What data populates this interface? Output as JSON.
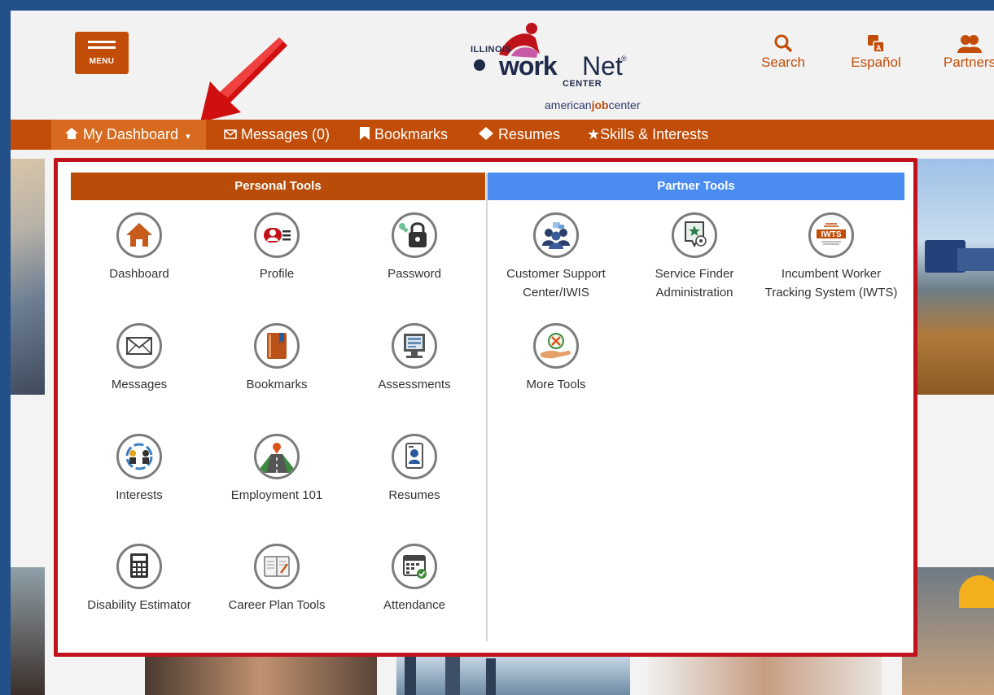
{
  "header": {
    "menu_label": "MENU",
    "logo": {
      "state": "ILLINOIS",
      "brand_work": "work",
      "brand_net": "Net",
      "reg": "®",
      "center": "CENTER",
      "ajc_pre": "american",
      "ajc_job": "job",
      "ajc_post": "center"
    },
    "links": [
      {
        "label": "Search",
        "icon": "search-icon"
      },
      {
        "label": "Español",
        "icon": "translate-icon"
      },
      {
        "label": "Partners",
        "icon": "people-icon"
      }
    ]
  },
  "nav": {
    "items": [
      {
        "label": "My Dashboard",
        "icon": "home-icon"
      },
      {
        "label": "Messages (0)",
        "icon": "envelope-icon"
      },
      {
        "label": "Bookmarks",
        "icon": "bookmark-icon"
      },
      {
        "label": "Resumes",
        "icon": "diamond-icon"
      },
      {
        "label": "Skills & Interests",
        "icon": "star-icon"
      }
    ]
  },
  "dropdown": {
    "personal": {
      "title": "Personal Tools",
      "tools": [
        {
          "label": "Dashboard",
          "icon": "house-icon"
        },
        {
          "label": "Profile",
          "icon": "profile-icon"
        },
        {
          "label": "Password",
          "icon": "lock-key-icon"
        },
        {
          "label": "Messages",
          "icon": "envelope-icon"
        },
        {
          "label": "Bookmarks",
          "icon": "book-icon"
        },
        {
          "label": "Assessments",
          "icon": "computer-icon"
        },
        {
          "label": "Interests",
          "icon": "interests-icon"
        },
        {
          "label": "Employment 101",
          "icon": "road-pin-icon"
        },
        {
          "label": "Resumes",
          "icon": "resume-icon"
        },
        {
          "label": "Disability Estimator",
          "icon": "calculator-icon"
        },
        {
          "label": "Career Plan Tools",
          "icon": "notebook-icon"
        },
        {
          "label": "Attendance",
          "icon": "calendar-check-icon"
        }
      ]
    },
    "partner": {
      "title": "Partner Tools",
      "tools": [
        {
          "label_line1": "Customer Support",
          "label_line2": "Center/IWIS",
          "icon": "support-group-icon"
        },
        {
          "label_line1": "Service Finder",
          "label_line2": "Administration",
          "icon": "map-star-icon"
        },
        {
          "label_line1": "Incumbent Worker",
          "label_line2": "Tracking System (IWTS)",
          "icon": "iwts-icon",
          "badge": "IWTS"
        },
        {
          "label_line1": "More Tools",
          "label_line2": "",
          "icon": "tools-hand-icon"
        }
      ]
    }
  },
  "colors": {
    "brand_orange": "#c14d08",
    "partner_blue": "#4a8cf0",
    "highlight_red": "#c0121a",
    "frame_blue": "#24508a"
  }
}
